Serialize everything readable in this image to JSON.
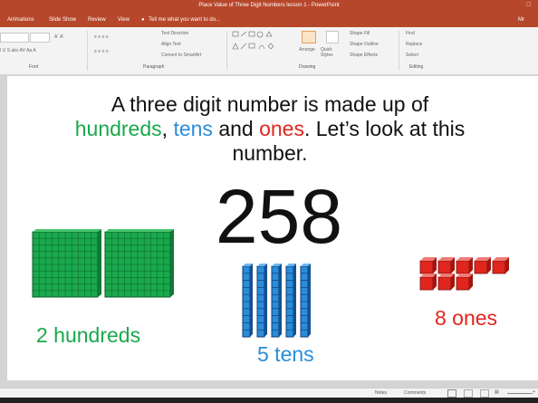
{
  "window": {
    "title": "Place Value of Three Digit Numbers lesson 1 - PowerPoint",
    "user": "Mr"
  },
  "tabs": [
    "Animations",
    "Slide Show",
    "Review",
    "View"
  ],
  "tell_me": "Tell me what you want to do...",
  "ribbon": {
    "groups": [
      "Font",
      "Paragraph",
      "Drawing",
      "Editing"
    ],
    "paragraph_items": [
      "Text Direction",
      "Align Text",
      "Convert to SmartArt"
    ],
    "drawing_items": [
      "Arrange",
      "Quick Styles",
      "Shape Fill",
      "Shape Outline",
      "Shape Effects"
    ],
    "editing_items": [
      "Find",
      "Replace",
      "Select"
    ]
  },
  "slide": {
    "line1": "A three digit number is made up of",
    "hundreds": "hundreds",
    "comma": ",",
    "tens": "tens",
    "and": "and",
    "ones": "ones",
    "rest": ". Let’s look at this",
    "line3": "number.",
    "number": "258",
    "hundreds_label": "2 hundreds",
    "tens_label": "5 tens",
    "ones_label": "8 ones",
    "blocks": {
      "hundreds": 2,
      "tens": 5,
      "ones": 8
    }
  },
  "colors": {
    "hundreds": "#1aa84d",
    "tens": "#2a8dd8",
    "ones": "#e0261f",
    "titlebar": "#b7472a"
  },
  "statusbar": {
    "notes": "Notes",
    "comments": "Comments",
    "zoom": "+"
  }
}
